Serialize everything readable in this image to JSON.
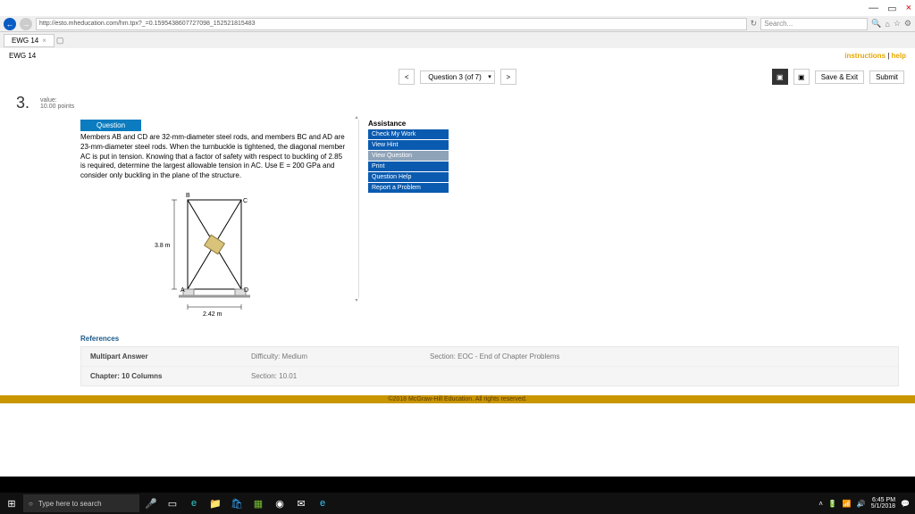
{
  "window": {
    "min": "—",
    "max": "▭",
    "close": "×"
  },
  "addr": {
    "url": "http://esto.mheducation.com/hm.tpx?_=0.1595438607727098_152521815483",
    "refresh": "↻",
    "search_placeholder": "Search...",
    "magnify": "🔍",
    "home": "⌂",
    "star": "☆",
    "gear": "⚙"
  },
  "tabs": {
    "t1": "EWG 14",
    "close": "×",
    "new": "▢"
  },
  "header": {
    "left": "EWG 14",
    "link1": "instructions",
    "sep": " | ",
    "link2": "help"
  },
  "nav": {
    "prev": "<",
    "label": "Question 3 (of 7)",
    "next": ">",
    "icon1": "▣",
    "icon2": "▣",
    "save": "Save & Exit",
    "submit": "Submit"
  },
  "question": {
    "num": "3.",
    "value_lbl": "value:",
    "points": "10.00 points",
    "tab": "Question",
    "text": "Members AB and CD are 32-mm-diameter steel rods, and members BC and AD are 23-mm-diameter steel rods. When the turnbuckle is tightened, the diagonal member AC is put in tension. Knowing that a factor of safety with respect to buckling of 2.85 is required, determine the largest allowable tension in AC. Use E = 200 GPa and consider only buckling in the plane of the structure.",
    "dim_v": "3.8 m",
    "dim_h": "2.42 m",
    "lblA": "A",
    "lblB": "B",
    "lblC": "C",
    "lblD": "D"
  },
  "assist": {
    "title": "Assistance",
    "b1": "Check My Work",
    "b2": "View Hint",
    "b3": "View Question",
    "b4": "Print",
    "b5": "Question Help",
    "b6": "Report a Problem"
  },
  "refs": "References",
  "meta": {
    "r1c1": "Multipart Answer",
    "r1c2": "Difficulty: Medium",
    "r1c3": "Section: EOC - End of Chapter Problems",
    "r2c1": "Chapter: 10  Columns",
    "r2c2": "Section: 10.01",
    "r2c3": ""
  },
  "footer": "©2018 McGraw-Hill Education. All rights reserved.",
  "taskbar": {
    "search": "Type here to search",
    "time": "6:45 PM",
    "date": "5/1/2018"
  }
}
